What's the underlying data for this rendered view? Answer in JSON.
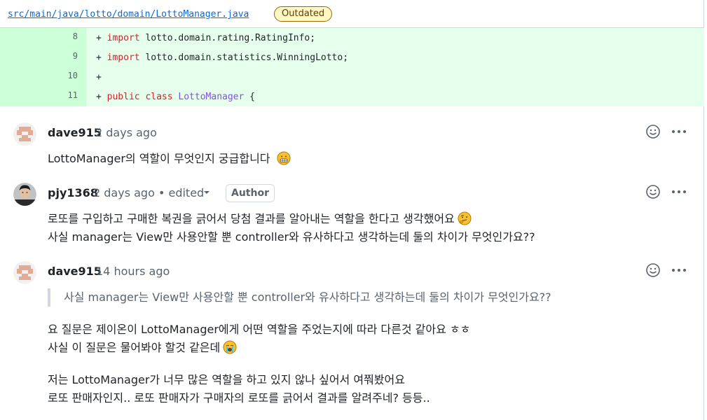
{
  "file": {
    "path": "src/main/java/lotto/domain/LottoManager.java",
    "outdated_label": "Outdated"
  },
  "diff_lines": [
    {
      "num": "8",
      "plus": "+",
      "kw": "import",
      "rest": " lotto.domain.rating.RatingInfo;"
    },
    {
      "num": "9",
      "plus": "+",
      "kw": "import",
      "rest": " lotto.domain.statistics.WinningLotto;"
    },
    {
      "num": "10",
      "plus": "+"
    },
    {
      "num": "11",
      "plus": "+",
      "kw": "public class",
      "cls": "LottoManager",
      "rest": " {"
    }
  ],
  "comments": [
    {
      "author": "dave915",
      "time": "2 days ago",
      "lines": [
        "LottoManager의 역할이 무엇인지 궁급합니다"
      ],
      "emoji": "grimacing-emoji"
    },
    {
      "author": "pjy1368",
      "time": "2 days ago • edited",
      "badge": "Author",
      "lines": [
        "로또를 구입하고 구매한 복권을 긁어서 당첨 결과를 알아내는 역할을 한다고 생각했어요",
        "사실 manager는 View만 사용안할 뿐 controller와 유사하다고 생각하는데 둘의 차이가 무엇인가요??"
      ],
      "emoji": "thinking-emoji"
    },
    {
      "author": "dave915",
      "time": "14 hours ago",
      "quote": "사실 manager는 View만 사용안할 뿐 controller와 유사하다고 생각하는데 둘의 차이가 무엇인가요??",
      "para1": [
        "요 질문은 제이온이 LottoManager에게 어떤 역할을 주었는지에 따라 다른것 같아요 ㅎㅎ",
        "사실 이 질문은 물어봐야 할것 같은데"
      ],
      "para2": [
        "저는 LottoManager가 너무 많은 역할을 하고 있지 않나 싶어서 여쭤봤어요",
        "로또 판매자인지.. 로또 판매자가 구매자의 로또를 긁어서 결과를 알려주네? 등등.."
      ],
      "emoji": "crying-emoji"
    }
  ],
  "icons": {
    "reaction": "smiley-icon",
    "more": "kebab-horizontal-icon",
    "dropdown": "triangle-down-icon"
  },
  "colors": {
    "added_num_bg": "#ccffd8",
    "added_code_bg": "#e6ffec",
    "keyword": "#cf222e",
    "class_name": "#8250df",
    "link": "#0969da"
  }
}
